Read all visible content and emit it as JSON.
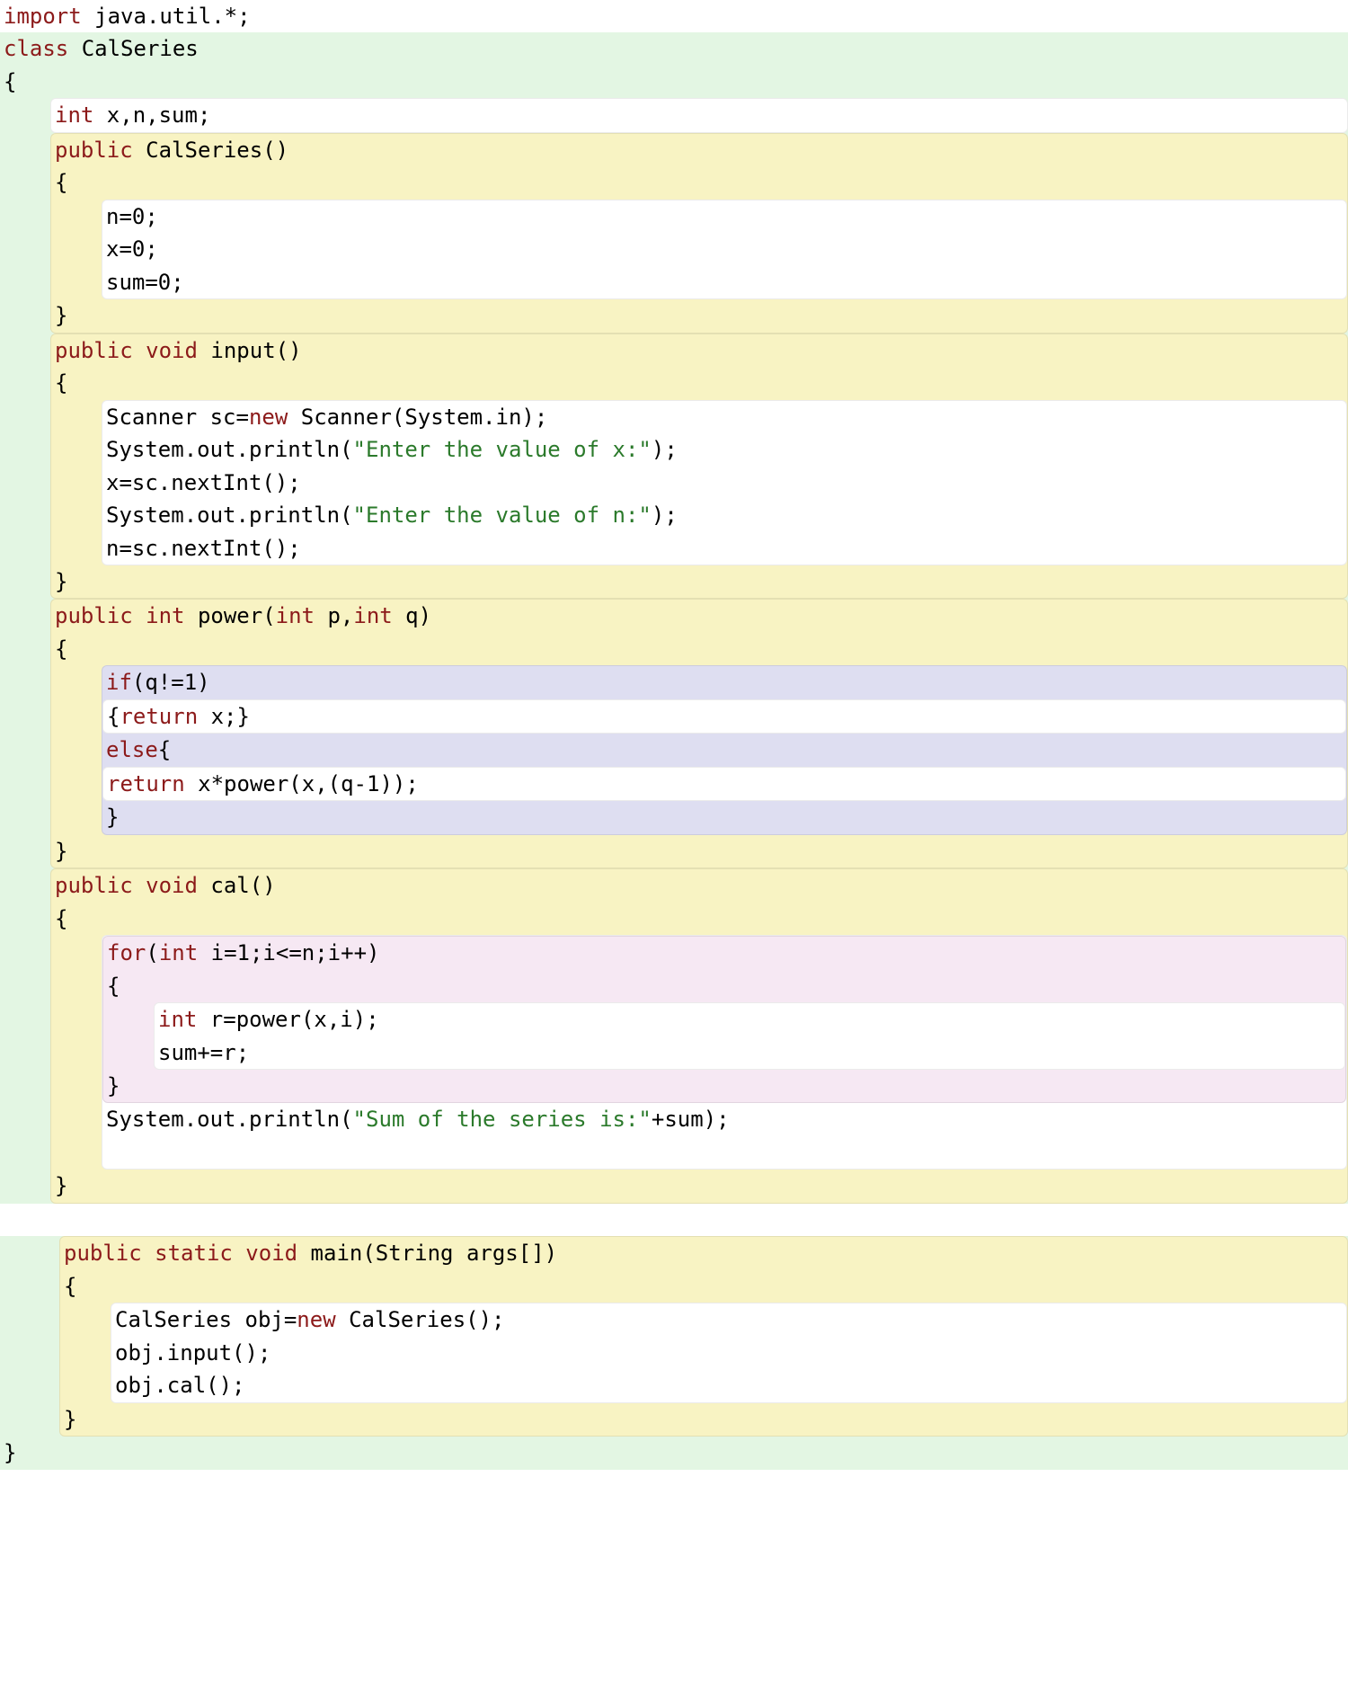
{
  "code": {
    "l01a": "import",
    "l01b": " java.util.*;",
    "l02a": "class",
    "l02b": " CalSeries",
    "l03": "{",
    "l04a": "int",
    "l04b": " x,n,sum;",
    "l05a": "public",
    "l05b": " CalSeries()",
    "l06": "{",
    "l07": "n=0;",
    "l08": "x=0;",
    "l09": "sum=0;",
    "l10": "}",
    "l11a": "public",
    "l11b": " void",
    "l11c": " input()",
    "l12": "{",
    "l13a": "Scanner sc=",
    "l13b": "new",
    "l13c": " Scanner(System.in);",
    "l14a": "System.out.println(",
    "l14b": "\"Enter the value of x:\"",
    "l14c": ");",
    "l15": "x=sc.nextInt();",
    "l16a": "System.out.println(",
    "l16b": "\"Enter the value of n:\"",
    "l16c": ");",
    "l17": "n=sc.nextInt();",
    "l18": "}",
    "l19a": "public",
    "l19b": " int",
    "l19c": " power(",
    "l19d": "int",
    "l19e": " p,",
    "l19f": "int",
    "l19g": " q)",
    "l20": "{",
    "l21a": "if",
    "l21b": "(q!=1)",
    "l22a": "{",
    "l22b": "return",
    "l22c": " x;}",
    "l23a": "else",
    "l23b": "{",
    "l24a": "return",
    "l24b": " x*power(x,(q-1));",
    "l25": "}",
    "l26": "}",
    "l27a": "public",
    "l27b": " void",
    "l27c": " cal()",
    "l28": "{",
    "l29a": "for",
    "l29b": "(",
    "l29c": "int",
    "l29d": " i=1;i<=n;i++)",
    "l30": "{",
    "l31a": "int",
    "l31b": " r=power(x,i);",
    "l32": "sum+=r;",
    "l33": "}",
    "l34a": "System.out.println(",
    "l34b": "\"Sum of the series is:\"",
    "l34c": "+sum);",
    "l35": "}",
    "l36a": "public",
    "l36b": " static",
    "l36c": " void",
    "l36d": " main(String args[])",
    "l37": "{",
    "l38a": "CalSeries obj=",
    "l38b": "new",
    "l38c": " CalSeries();",
    "l39": "obj.input();",
    "l40": "obj.cal();",
    "l41": "}",
    "l42": "}"
  }
}
